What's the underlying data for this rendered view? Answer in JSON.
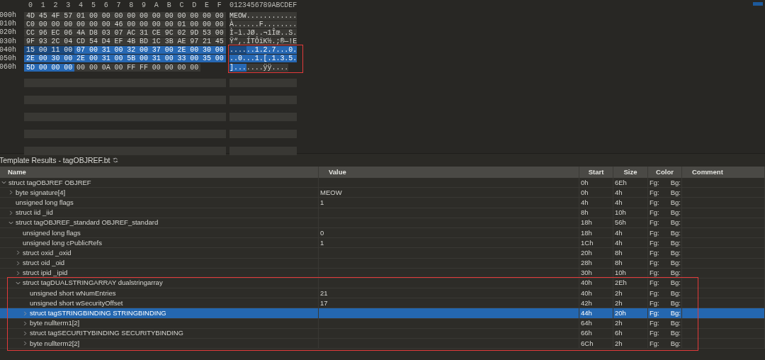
{
  "hex": {
    "column_header": [
      "0",
      "1",
      "2",
      "3",
      "4",
      "5",
      "6",
      "7",
      "8",
      "9",
      "A",
      "B",
      "C",
      "D",
      "E",
      "F"
    ],
    "ascii_header": "0123456789ABCDEF",
    "ascii_outlined": true,
    "rows": [
      {
        "offset": "000h",
        "segments": [
          {
            "selected": false,
            "parent": false,
            "bytes": [
              "4D",
              "45",
              "4F",
              "57",
              "01",
              "00",
              "00",
              "00",
              "00",
              "00",
              "00",
              "00",
              "00",
              "00",
              "00",
              "00"
            ]
          }
        ],
        "ascii": [
          {
            "selected": false,
            "parent": false,
            "text": "MEOW............"
          }
        ]
      },
      {
        "offset": "010h",
        "segments": [
          {
            "selected": false,
            "parent": false,
            "bytes": [
              "C0",
              "00",
              "00",
              "00",
              "00",
              "00",
              "00",
              "46",
              "00",
              "00",
              "00",
              "00",
              "01",
              "00",
              "00",
              "00"
            ]
          }
        ],
        "ascii": [
          {
            "selected": false,
            "parent": false,
            "text": "À......F........"
          }
        ]
      },
      {
        "offset": "020h",
        "segments": [
          {
            "selected": false,
            "parent": false,
            "bytes": [
              "CC",
              "96",
              "EC",
              "06",
              "4A",
              "D8",
              "03",
              "07",
              "AC",
              "31",
              "CE",
              "9C",
              "02",
              "9D",
              "53",
              "00"
            ]
          }
        ],
        "ascii": [
          {
            "selected": false,
            "parent": false,
            "text": "Ì–ì.JØ..¬1Îœ..S."
          }
        ]
      },
      {
        "offset": "030h",
        "segments": [
          {
            "selected": false,
            "parent": false,
            "bytes": [
              "9F",
              "93",
              "2C",
              "04",
              "CD",
              "54",
              "D4",
              "EF",
              "4B",
              "BD",
              "1C",
              "3B",
              "AE",
              "97",
              "21",
              "45"
            ]
          }
        ],
        "ascii": [
          {
            "selected": false,
            "parent": false,
            "text": "Ÿ“,.ÍTÔïK½.;®—!E"
          }
        ]
      },
      {
        "offset": "040h",
        "segments": [
          {
            "selected": false,
            "parent": true,
            "bytes": [
              "15",
              "00",
              "11",
              "00"
            ]
          },
          {
            "selected": true,
            "parent": false,
            "bytes": [
              "07",
              "00",
              "31",
              "00",
              "32",
              "00",
              "37",
              "00",
              "2E",
              "00",
              "30",
              "00"
            ]
          }
        ],
        "ascii": [
          {
            "selected": false,
            "parent": true,
            "text": "...."
          },
          {
            "selected": true,
            "parent": false,
            "text": "..1.2.7...0."
          }
        ]
      },
      {
        "offset": "050h",
        "segments": [
          {
            "selected": true,
            "parent": false,
            "bytes": [
              "2E",
              "00",
              "30",
              "00",
              "2E",
              "00",
              "31",
              "00",
              "5B",
              "00",
              "31",
              "00",
              "33",
              "00",
              "35",
              "00"
            ]
          }
        ],
        "ascii": [
          {
            "selected": true,
            "parent": false,
            "text": "..0...1.[.1.3.5."
          }
        ]
      },
      {
        "offset": "060h",
        "segments": [
          {
            "selected": true,
            "parent": false,
            "bytes": [
              "5D",
              "00",
              "00",
              "00"
            ]
          },
          {
            "selected": false,
            "parent": false,
            "bytes": [
              "00",
              "00",
              "0A",
              "00",
              "FF",
              "FF",
              "00",
              "00",
              "00",
              "00"
            ]
          }
        ],
        "ascii": [
          {
            "selected": true,
            "parent": false,
            "text": "]..."
          },
          {
            "selected": false,
            "parent": false,
            "text": "....ÿÿ...."
          }
        ]
      }
    ]
  },
  "template": {
    "title": "Template Results - tagOBJREF.bt",
    "columns": [
      "Name",
      "Value",
      "Start",
      "Size",
      "Color",
      "Comment"
    ],
    "rows": [
      {
        "name": "struct tagOBJREF OBJREF",
        "start": "0h",
        "size": "6Eh",
        "fg": "Fg:",
        "bg": "Bg:",
        "expanded": true,
        "selected": false,
        "children": [
          {
            "name": "byte signature[4]",
            "value": "MEOW",
            "start": "0h",
            "size": "4h",
            "fg": "Fg:",
            "bg": "Bg:",
            "expanded": false,
            "selected": false
          },
          {
            "name": "unsigned long flags",
            "value": "1",
            "start": "4h",
            "size": "4h",
            "fg": "Fg:",
            "bg": "Bg:",
            "selected": false
          },
          {
            "name": "struct iid _iid",
            "start": "8h",
            "size": "10h",
            "fg": "Fg:",
            "bg": "Bg:",
            "expanded": false,
            "selected": false
          },
          {
            "name": "struct tagOBJREF_standard OBJREF_standard",
            "start": "18h",
            "size": "56h",
            "fg": "Fg:",
            "bg": "Bg:",
            "expanded": true,
            "selected": false,
            "children": [
              {
                "name": "unsigned long flags",
                "value": "0",
                "start": "18h",
                "size": "4h",
                "fg": "Fg:",
                "bg": "Bg:",
                "selected": false
              },
              {
                "name": "unsigned long cPublicRefs",
                "value": "1",
                "start": "1Ch",
                "size": "4h",
                "fg": "Fg:",
                "bg": "Bg:",
                "selected": false
              },
              {
                "name": "struct oxid _oxid",
                "start": "20h",
                "size": "8h",
                "fg": "Fg:",
                "bg": "Bg:",
                "expanded": false,
                "selected": false
              },
              {
                "name": "struct oid _oid",
                "start": "28h",
                "size": "8h",
                "fg": "Fg:",
                "bg": "Bg:",
                "expanded": false,
                "selected": false
              },
              {
                "name": "struct ipid _ipid",
                "start": "30h",
                "size": "10h",
                "fg": "Fg:",
                "bg": "Bg:",
                "expanded": false,
                "selected": false
              },
              {
                "name": "struct tagDUALSTRINGARRAY dualstringarray",
                "start": "40h",
                "size": "2Eh",
                "fg": "Fg:",
                "bg": "Bg:",
                "expanded": true,
                "selected": false,
                "outlined": true,
                "children": [
                  {
                    "name": "unsigned short wNumEntries",
                    "value": "21",
                    "start": "40h",
                    "size": "2h",
                    "fg": "Fg:",
                    "bg": "Bg:",
                    "selected": false
                  },
                  {
                    "name": "unsigned short wSecurityOffset",
                    "value": "17",
                    "start": "42h",
                    "size": "2h",
                    "fg": "Fg:",
                    "bg": "Bg:",
                    "selected": false
                  },
                  {
                    "name": "struct tagSTRINGBINDING STRINGBINDING",
                    "start": "44h",
                    "size": "20h",
                    "fg": "Fg:",
                    "bg": "Bg:",
                    "expanded": false,
                    "selected": true
                  },
                  {
                    "name": "byte nullterm1[2]",
                    "start": "64h",
                    "size": "2h",
                    "fg": "Fg:",
                    "bg": "Bg:",
                    "expanded": false,
                    "selected": false
                  },
                  {
                    "name": "struct tagSECURITYBINDING SECURITYBINDING",
                    "start": "66h",
                    "size": "6h",
                    "fg": "Fg:",
                    "bg": "Bg:",
                    "expanded": false,
                    "selected": false
                  },
                  {
                    "name": "byte nullterm2[2]",
                    "start": "6Ch",
                    "size": "2h",
                    "fg": "Fg:",
                    "bg": "Bg:",
                    "expanded": false,
                    "selected": false
                  }
                ]
              }
            ]
          }
        ]
      }
    ]
  }
}
